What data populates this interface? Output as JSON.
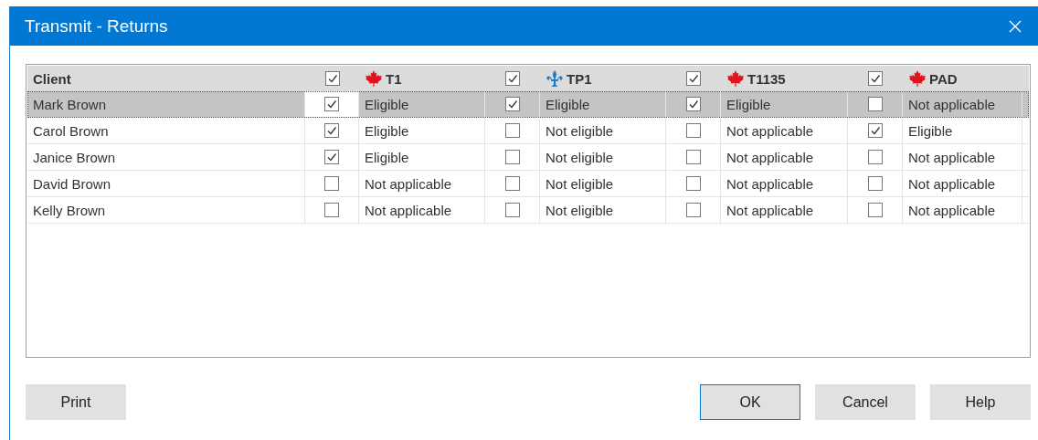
{
  "window": {
    "title": "Transmit - Returns"
  },
  "table": {
    "client_heading": "Client",
    "returns": [
      {
        "label": "T1",
        "kind": "federal",
        "checked": true
      },
      {
        "label": "TP1",
        "kind": "quebec",
        "checked": true
      },
      {
        "label": "T1135",
        "kind": "federal",
        "checked": true
      },
      {
        "label": "PAD",
        "kind": "federal",
        "checked": true
      }
    ],
    "rows": [
      {
        "client": "Mark Brown",
        "selected": true,
        "cells": [
          {
            "checked": true,
            "status": "Eligible"
          },
          {
            "checked": true,
            "status": "Eligible"
          },
          {
            "checked": true,
            "status": "Eligible"
          },
          {
            "checked": false,
            "status": "Not applicable"
          }
        ]
      },
      {
        "client": "Carol Brown",
        "selected": false,
        "cells": [
          {
            "checked": true,
            "status": "Eligible"
          },
          {
            "checked": false,
            "status": "Not eligible"
          },
          {
            "checked": false,
            "status": "Not applicable"
          },
          {
            "checked": true,
            "status": "Eligible"
          }
        ]
      },
      {
        "client": "Janice Brown",
        "selected": false,
        "cells": [
          {
            "checked": true,
            "status": "Eligible"
          },
          {
            "checked": false,
            "status": "Not eligible"
          },
          {
            "checked": false,
            "status": "Not applicable"
          },
          {
            "checked": false,
            "status": "Not applicable"
          }
        ]
      },
      {
        "client": "David Brown",
        "selected": false,
        "cells": [
          {
            "checked": false,
            "status": "Not applicable"
          },
          {
            "checked": false,
            "status": "Not eligible"
          },
          {
            "checked": false,
            "status": "Not applicable"
          },
          {
            "checked": false,
            "status": "Not applicable"
          }
        ]
      },
      {
        "client": "Kelly Brown",
        "selected": false,
        "cells": [
          {
            "checked": false,
            "status": "Not applicable"
          },
          {
            "checked": false,
            "status": "Not eligible"
          },
          {
            "checked": false,
            "status": "Not applicable"
          },
          {
            "checked": false,
            "status": "Not applicable"
          }
        ]
      }
    ]
  },
  "buttons": [
    {
      "label": "Print",
      "default": false
    },
    {
      "label": "OK",
      "default": true
    },
    {
      "label": "Cancel",
      "default": false
    },
    {
      "label": "Help",
      "default": false
    }
  ]
}
